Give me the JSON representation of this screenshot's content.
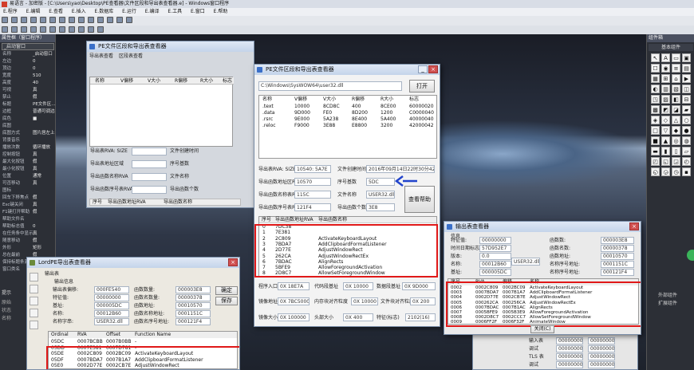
{
  "app": {
    "title": "易语言 - 加密版 - [C:\\Users\\yao\\Desktop\\PE查看器\\文件区段和导出表查看器.e] - Windows窗口程序",
    "menu": [
      "E.程序",
      "E.编辑",
      "E.查看",
      "E.插入",
      "E.数据库",
      "E.运行",
      "E.编译",
      "E.工具",
      "E.窗口",
      "E.帮助"
    ]
  },
  "props": {
    "header": "属性框（窗口程序）",
    "combo": "_启动窗口",
    "rows": [
      [
        "名称",
        "_启动窗口"
      ],
      [
        "左边",
        "0"
      ],
      [
        "顶边",
        "0"
      ],
      [
        "宽度",
        "510"
      ],
      [
        "高度",
        "40"
      ],
      [
        "可视",
        "真"
      ],
      [
        "禁止",
        "假"
      ],
      [
        "标题",
        "PE文件区..."
      ],
      [
        "边框",
        "普通可调边框"
      ],
      [
        "底色",
        "■"
      ],
      [
        "底图",
        ""
      ],
      [
        "底图方式",
        "图片居左上"
      ],
      [
        "背景音乐",
        ""
      ],
      [
        "播放次数",
        "循环播放"
      ],
      [
        "控制按钮",
        "真"
      ],
      [
        "最大化按钮",
        "假"
      ],
      [
        "最小化按钮",
        "真"
      ],
      [
        "位置",
        "通常"
      ],
      [
        "可否移动",
        "真"
      ],
      [
        "图标",
        ""
      ],
      [
        "回车下移焦点",
        "假"
      ],
      [
        "Esc键关闭",
        "真"
      ],
      [
        "F1键打开帮助",
        "假"
      ],
      [
        "帮助文件名",
        ""
      ],
      [
        "帮助标志值",
        "0"
      ],
      [
        "在任务条中显示",
        "真"
      ],
      [
        "随意移动",
        "假"
      ],
      [
        "外形",
        "矩形"
      ],
      [
        "总在最前",
        "假"
      ],
      [
        "保持标题条激活",
        "假"
      ],
      [
        "窗口类名",
        ""
      ]
    ]
  },
  "designer": {
    "title": "PE文件区段和导出表查看器",
    "tabs": [
      "导出表查看",
      "区段表查看"
    ],
    "columns": [
      "名称",
      "V偏移",
      "V大小",
      "R偏移",
      "R大小",
      "标志"
    ],
    "labels": [
      "导出表RVA: SIZE",
      "导出表地址区域",
      "导出函数名称RVA",
      "导出函数序号表RVA"
    ],
    "right_labels": [
      "文件创建时间",
      "序号基数",
      "文件名称",
      "导出函数个数"
    ],
    "bottom_cols": [
      "序号",
      "导出函数地址RVA",
      "导出函数名称"
    ]
  },
  "pe": {
    "title": "PE文件区段和导出表查看器",
    "path": "C:\\Windows\\SysWOW64\\user32.dll",
    "open_button": "打开",
    "sec_headers": [
      "名称",
      "V偏移",
      "V大小",
      "R偏移",
      "R大小",
      "标志"
    ],
    "sections": [
      [
        ".text",
        "10000",
        "8CD8C",
        "400",
        "8CE00",
        "60000020"
      ],
      [
        ".data",
        "9D000",
        "FE0",
        "8D200",
        "1200",
        "C0000040"
      ],
      [
        ".rsrc",
        "9E000",
        "5A238",
        "8E400",
        "5A400",
        "40000040"
      ],
      [
        ".reloc",
        "F9000",
        "3E88",
        "E8800",
        "3200",
        "42000042"
      ]
    ],
    "lbl_exp_rva": "导出表RVA: SIZE",
    "val_exp_rva": "10540: 5A7E",
    "lbl_func_addr": "导出函数地址区RVA",
    "val_func_addr": "10570",
    "lbl_func_name": "导出函数名称表RVA",
    "val_func_name": "115C",
    "lbl_func_ord": "导出函数序号表RVA",
    "val_func_ord": "121F4",
    "lbl_time": "文件创建时间",
    "val_time": "2016年09月14日22时30分42秒",
    "lbl_base": "序号基数",
    "val_base": "5DC",
    "lbl_name": "文件名称",
    "val_name": "USER32.dll",
    "lbl_count": "导出函数个数",
    "val_count": "3E8",
    "lookup_btn": "查看帮助",
    "exp_headers": [
      "序号",
      "导出函数地址RVA",
      "导出函数名称"
    ],
    "exports": [
      [
        "0",
        "7DC38",
        "",
        ""
      ],
      [
        "1",
        "7E381",
        "",
        ""
      ],
      [
        "2",
        "2C809",
        "",
        "ActivateKeyboardLayout"
      ],
      [
        "3",
        "7BDA7",
        "",
        "AddClipboardFormatListener"
      ],
      [
        "4",
        "2D77E",
        "",
        "AdjustWindowRect"
      ],
      [
        "5",
        "262CA",
        "",
        "AdjustWindowRectEx"
      ],
      [
        "6",
        "7BDAC",
        "",
        "AlignRects"
      ],
      [
        "7",
        "5BFE9",
        "",
        "AllowForegroundActivation"
      ],
      [
        "8",
        "2D8C7",
        "",
        "AllowSetForegroundWindow"
      ]
    ],
    "lbl_entry": "程序入口点",
    "val_entry": "0X 18E7A",
    "lbl_codebase": "代码段基址",
    "val_codebase": "0X 10000",
    "lbl_databn": "数据段基址",
    "val_databn": "0X 9D000",
    "lbl_imgbase": "镜像地址",
    "val_imgbase": "0X 7BC50000",
    "lbl_secalign": "内存块对齐粒度",
    "val_secalign": "0X 10000",
    "lbl_filealign": "文件块对齐粒度",
    "val_filealign": "0X 200",
    "lbl_imgsize": "镜像大小",
    "val_imgsize": "0X 100000",
    "lbl_hdrsize": "头部大小",
    "val_hdrsize": "0X 400",
    "lbl_chars": "特征(标志)",
    "val_chars": "2102(16)"
  },
  "lordpe": {
    "title": "LordPE导出表查看器",
    "group": "输出表",
    "sub": "输出信息",
    "fields": [
      [
        "输出表偏移:",
        "000FE540"
      ],
      [
        "特征值:",
        "00000000"
      ],
      [
        "基址:",
        "000005DC"
      ],
      [
        "名称:",
        "00012B60"
      ],
      [
        "名称字串:",
        "USER32.dll"
      ]
    ],
    "fields2": [
      [
        "函数数量:",
        "000003E8"
      ],
      [
        "函数名数量:",
        "00000378"
      ],
      [
        "函数地址:",
        "00010570"
      ],
      [
        "函数名称地址:",
        "0001151C"
      ],
      [
        "函数名序号地址:",
        "000121F4"
      ]
    ],
    "ok": "确定",
    "save": "保存",
    "cols": [
      "Ordinal",
      "RVA",
      "Offset",
      "Function Name"
    ],
    "rows": [
      [
        "05DC",
        "0007BCBB",
        "0007B0BB",
        "-"
      ],
      [
        "05DD",
        "0007E381",
        "0007D781",
        "-"
      ],
      [
        "05DE",
        "0002C809",
        "0002BC09",
        "ActivateKeyboardLayout"
      ],
      [
        "05DF",
        "0007BDA7",
        "0007B1A7",
        "AddClipboardFormatListener"
      ],
      [
        "05E0",
        "0002D77E",
        "0002CB7E",
        "AdjustWindowRect"
      ]
    ]
  },
  "impexp": {
    "title": "输出表查看器",
    "group": "信息",
    "left": [
      [
        "特征值:",
        "00000000"
      ],
      [
        "时间日期标志:",
        "57D952E7"
      ],
      [
        "版本:",
        "0.0"
      ],
      [
        "名称:",
        "00012B60"
      ],
      [
        "基址:",
        "000005DC"
      ]
    ],
    "name_val": "USER32.dll",
    "right": [
      [
        "函数数:",
        "000003E8"
      ],
      [
        "函数名数:",
        "00000378"
      ],
      [
        "函数地址:",
        "00010570"
      ],
      [
        "名称序号地址:",
        "0001151C"
      ],
      [
        "名称序号地址:",
        "000121F4"
      ]
    ],
    "cols": [
      "序号",
      "RVA",
      "偏移",
      "名称"
    ],
    "rows": [
      [
        "0002",
        "0002C809",
        "0002BC09",
        "ActivateKeyboardLayout"
      ],
      [
        "0003",
        "0007BDA7",
        "0007B1A7",
        "AddClipboardFormatListener"
      ],
      [
        "0004",
        "0002D77E",
        "0002CB7E",
        "AdjustWindowRect"
      ],
      [
        "0005",
        "000262CA",
        "000256CA",
        "AdjustWindowRectEx"
      ],
      [
        "0006",
        "0007BDAC",
        "0007B1AC",
        "AlignRects"
      ],
      [
        "0007",
        "0005BFE9",
        "0005B3E9",
        "AllowForegroundActivation"
      ],
      [
        "0008",
        "0002D8C7",
        "0002CCC7",
        "AllowSetForegroundWindow"
      ],
      [
        "0009",
        "0006FF2F",
        "0006F32F",
        "AnimateWindow"
      ]
    ],
    "close": "关闭(C)"
  },
  "bgwin": {
    "rows": [
      [
        "输入表",
        "00000000"
      ],
      [
        "调试",
        "00000000"
      ],
      [
        "TLS 表",
        "00000000"
      ],
      [
        "调试",
        "00000000"
      ]
    ],
    "vals2": [
      "00000000",
      "00000000",
      "00000000",
      "00000000"
    ]
  },
  "toolbox": {
    "title": "组件箱",
    "tab": "基本组件",
    "items": [
      "外部组件",
      "扩展组件"
    ]
  },
  "status": {
    "left": "提示",
    "mid": "输出",
    "items": [
      "原始",
      "状态",
      "名称"
    ]
  }
}
